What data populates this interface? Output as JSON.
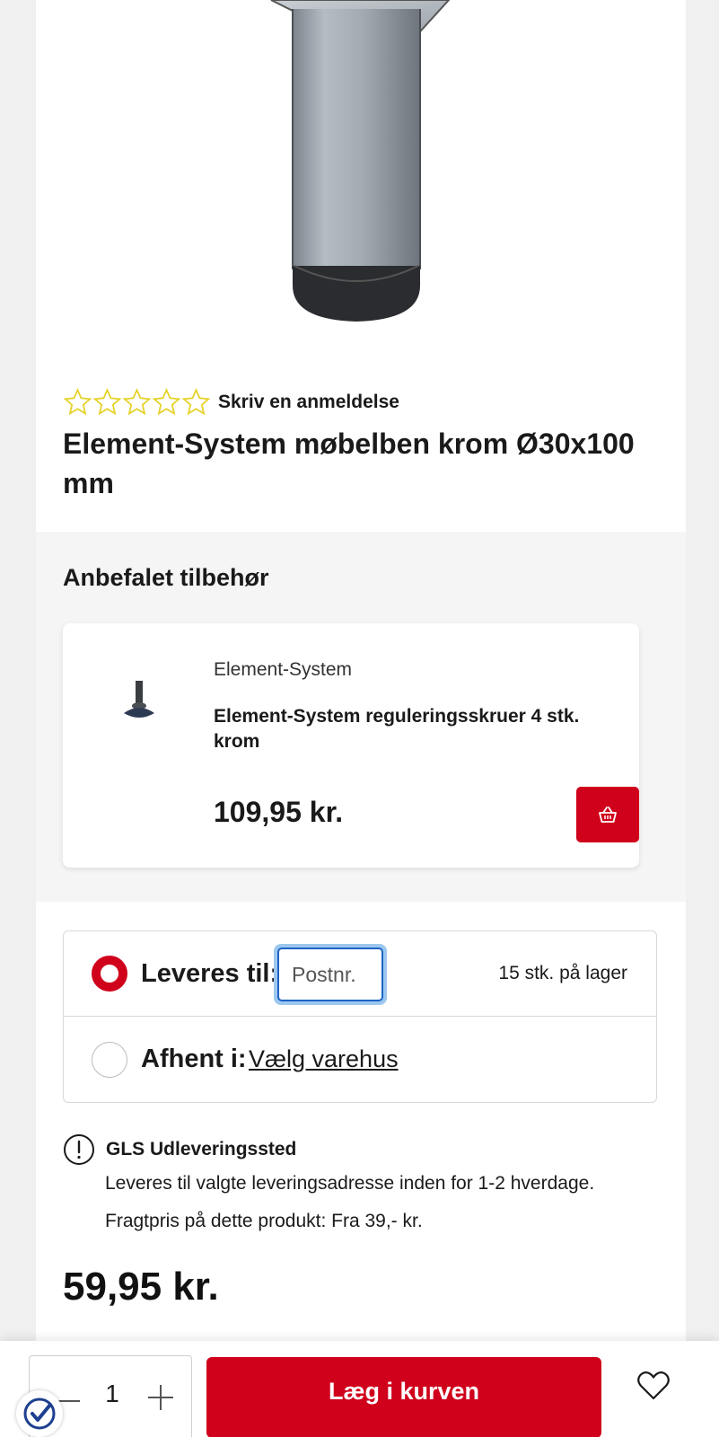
{
  "product": {
    "review_link": "Skriv en anmeldelse",
    "rating_stars": 0,
    "rating_max": 5,
    "title": "Element-System møbelben krom Ø30x100 mm",
    "price": "59,95 kr."
  },
  "accessories": {
    "heading": "Anbefalet tilbehør",
    "items": [
      {
        "brand": "Element-System",
        "name": "Element-System reguleringsskruer 4 stk. krom",
        "price": "109,95 kr.",
        "cart_icon": "basket-icon"
      }
    ]
  },
  "delivery": {
    "deliver_label": "Leveres til:",
    "postnr_placeholder": "Postnr.",
    "stock": "15 stk. på lager",
    "pickup_label": "Afhent i:",
    "store_link": "Vælg varehus",
    "selected_option": "deliver"
  },
  "shipping_info": {
    "icon": "info-icon",
    "title": "GLS Udleveringssted",
    "line1": "Leveres til valgte leveringsadresse inden for 1-2 hverdage.",
    "line2": "Fragtpris på dette produkt: Fra 39,- kr."
  },
  "cart_bar": {
    "quantity": "1",
    "add_to_cart": "Læg i kurven",
    "wishlist_icon": "heart-icon",
    "trust_icon": "checkmark-badge-icon"
  },
  "colors": {
    "accent_red": "#d0021b",
    "star_outline": "#e6d228",
    "focus_blue": "#1e63c5"
  }
}
